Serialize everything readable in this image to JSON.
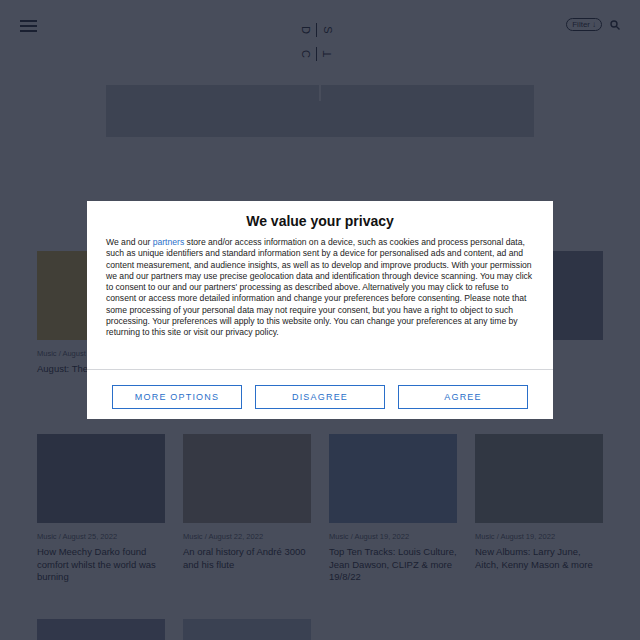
{
  "header": {
    "logo_letters": [
      "D",
      "S",
      "C",
      "T"
    ],
    "filter": {
      "label": "Filter",
      "arrow": "↓"
    }
  },
  "cards": [
    {
      "meta": "Music / August",
      "title": "August: The Tracks This",
      "color": "#d9b84a"
    },
    {
      "meta": "",
      "title": "",
      "color": "#9aa0aa"
    },
    {
      "meta": "",
      "title": "",
      "color": "#8c93a0"
    },
    {
      "meta": "",
      "title": "",
      "color": "#7d8492"
    },
    {
      "meta": "Music / August 25, 2022",
      "title": "How Meechy Darko found comfort whilst the world was burning",
      "color": "#6f7480"
    },
    {
      "meta": "Music / August 22, 2022",
      "title": "An oral history of André 3000 and his flute",
      "color": "#a3998a"
    },
    {
      "meta": "Music / August 19, 2022",
      "title": "Top Ten Tracks: Louis Culture, Jean Dawson, CLIPZ & more 19/8/22",
      "color": "#7f95b8"
    },
    {
      "meta": "Music / August 19, 2022",
      "title": "New Albums: Larry June, Aitch, Kenny Mason & more",
      "color": "#8a8f86"
    },
    {
      "meta": "",
      "title": "",
      "color": "#8d93a8"
    },
    {
      "meta": "",
      "title": "",
      "color": "#b7c2cf"
    }
  ],
  "consent": {
    "title": "We value your privacy",
    "body_before": "We and our ",
    "link": "partners",
    "body_after": " store and/or access information on a device, such as cookies and process personal data, such as unique identifiers and standard information sent by a device for personalised ads and content, ad and content measurement, and audience insights, as well as to develop and improve products. With your permission we and our partners may use precise geolocation data and identification through device scanning. You may click to consent to our and our partners' processing as described above. Alternatively you may click to refuse to consent or access more detailed information and change your preferences before consenting. Please note that some processing of your personal data may not require your consent, but you have a right to object to such processing. Your preferences will apply to this website only. You can change your preferences at any time by returning to this site or visit our privacy policy.",
    "buttons": [
      "MORE OPTIONS",
      "DISAGREE",
      "AGREE"
    ]
  }
}
